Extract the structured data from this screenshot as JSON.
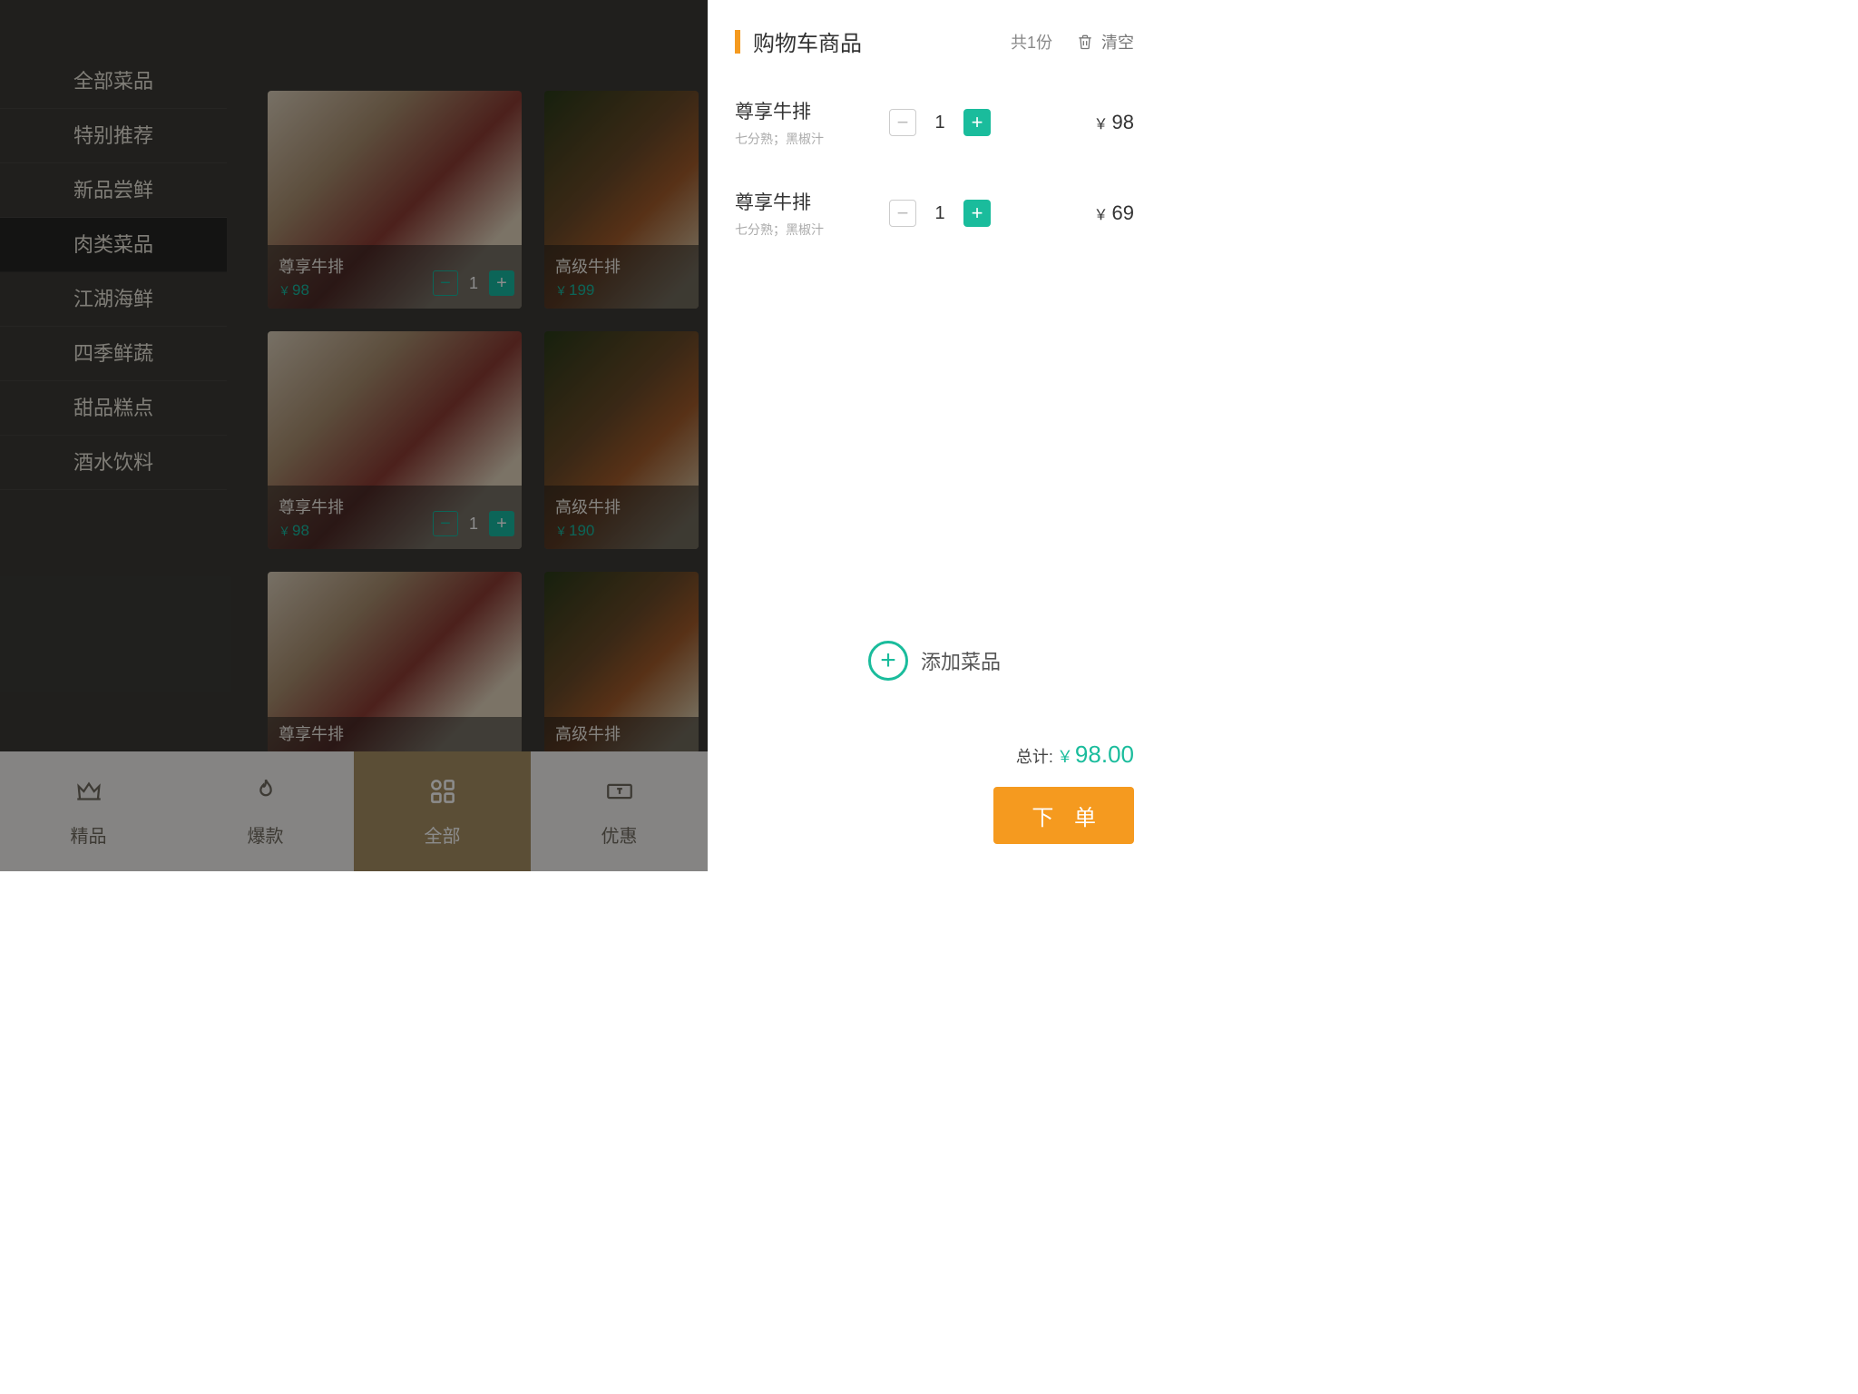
{
  "sidebar": {
    "items": [
      {
        "label": "全部菜品"
      },
      {
        "label": "特别推荐"
      },
      {
        "label": "新品尝鲜"
      },
      {
        "label": "肉类菜品"
      },
      {
        "label": "江湖海鲜"
      },
      {
        "label": "四季鲜蔬"
      },
      {
        "label": "甜品糕点"
      },
      {
        "label": "酒水饮料"
      }
    ],
    "activeIndex": 3
  },
  "dishes": [
    {
      "name": "尊享牛排",
      "price": "98",
      "qty": "1"
    },
    {
      "name": "高级牛排",
      "price": "199"
    },
    {
      "name": "尊享牛排",
      "price": "98",
      "qty": "1"
    },
    {
      "name": "高级牛排",
      "price": "190"
    },
    {
      "name": "尊享牛排"
    },
    {
      "name": "高级牛排"
    }
  ],
  "bottomTabs": [
    {
      "label": "精品",
      "icon": "crown"
    },
    {
      "label": "爆款",
      "icon": "fire"
    },
    {
      "label": "全部",
      "icon": "grid"
    },
    {
      "label": "优惠",
      "icon": "ticket"
    }
  ],
  "bottomActive": 2,
  "cart": {
    "title": "购物车商品",
    "countText": "共1份",
    "clear": "清空",
    "items": [
      {
        "name": "尊享牛排",
        "desc": "七分熟；黑椒汁",
        "qty": "1",
        "price": "98"
      },
      {
        "name": "尊享牛排",
        "desc": "七分熟；黑椒汁",
        "qty": "1",
        "price": "69"
      }
    ],
    "addDish": "添加菜品",
    "totalLabel": "总计:",
    "totalValue": "98.00",
    "orderBtn": "下 单"
  }
}
